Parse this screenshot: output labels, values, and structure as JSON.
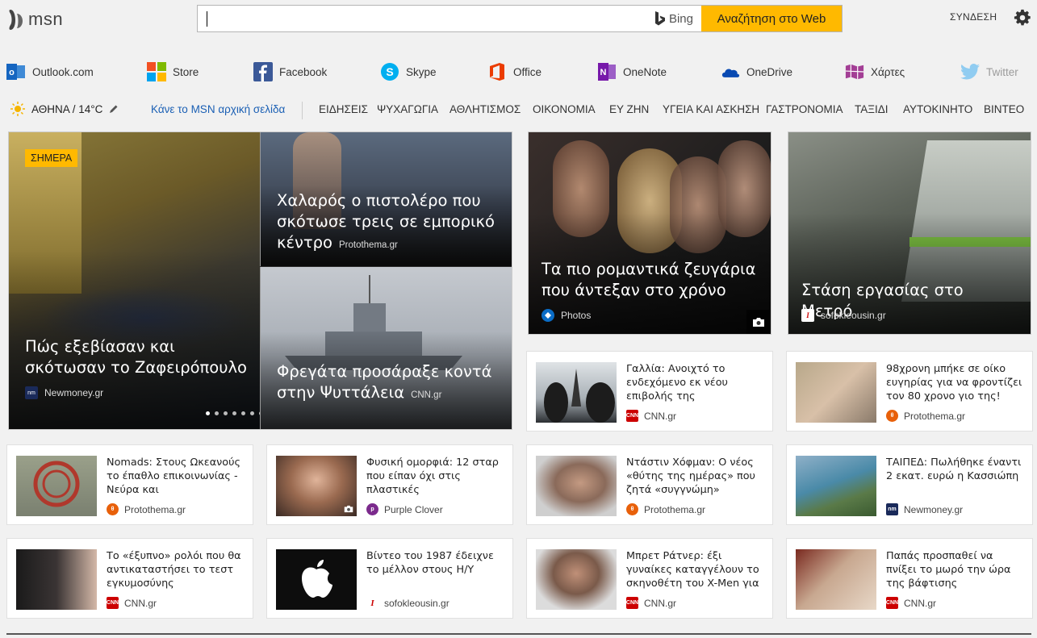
{
  "header": {
    "logo_text": "msn",
    "search_placeholder": "",
    "bing_label": "Bing",
    "search_button": "Αναζήτηση στο Web",
    "signin": "ΣΥΝΔΕΣΗ"
  },
  "services": [
    {
      "label": "Outlook.com",
      "icon": "outlook-icon"
    },
    {
      "label": "Store",
      "icon": "store-icon"
    },
    {
      "label": "Facebook",
      "icon": "facebook-icon"
    },
    {
      "label": "Skype",
      "icon": "skype-icon"
    },
    {
      "label": "Office",
      "icon": "office-icon"
    },
    {
      "label": "OneNote",
      "icon": "onenote-icon"
    },
    {
      "label": "OneDrive",
      "icon": "onedrive-icon"
    },
    {
      "label": "Χάρτες",
      "icon": "maps-icon"
    },
    {
      "label": "Twitter",
      "icon": "twitter-icon"
    }
  ],
  "weather": {
    "location": "ΑΘΗΝΑ / 14°C"
  },
  "make_homepage": "Κάνε το MSN αρχική σελίδα",
  "categories": [
    "ΕΙΔΗΣΕΙΣ",
    "ΨΥΧΑΓΩΓΙΑ",
    "ΑΘΛΗΤΙΣΜΟΣ",
    "ΟΙΚΟΝΟΜΙΑ",
    "ΕΥ ΖΗΝ",
    "ΥΓΕΙΑ ΚΑΙ ΑΣΚΗΣΗ",
    "ΓΑΣΤΡΟΝΟΜΙΑ",
    "ΤΑΞΙΔΙ",
    "ΑΥΤΟΚΙΝΗΤΟ",
    "ΒΙΝΤΕΟ"
  ],
  "hero": {
    "badge": "ΣΗΜΕΡΑ",
    "main": {
      "title": "Πώς εξεβίασαν και σκότωσαν το Ζαφειρόπουλο",
      "source": "Newmoney.gr"
    },
    "top_right": {
      "title": "Χαλαρός ο πιστολέρο που σκότωσε τρεις σε εμπορικό κέντρο",
      "source": "Protothema.gr"
    },
    "bottom_right": {
      "title": "Φρεγάτα προσάραξε κοντά στην Ψυττάλεια",
      "source": "CNN.gr"
    }
  },
  "big_tiles": [
    {
      "title": "Τα πιο ρομαντικά ζευγάρια που άντεξαν στο χρόνο",
      "source": "Photos"
    },
    {
      "title": "Στάση εργασίας στο Μετρό",
      "source": "sofokleousin.gr"
    }
  ],
  "cards": [
    {
      "title": "Γαλλία: Ανοιχτό το ενδεχόμενο εκ νέου επιβολής της κατάστασης...",
      "source": "CNN.gr"
    },
    {
      "title": "98χρονη μπήκε σε οίκο ευγηρίας για να φροντίζει τον 80 χρονο γιο της!",
      "source": "Protothema.gr"
    },
    {
      "title": "Nomads: Στους Ωκεανούς το έπαθλο επικοινωνίας - Νεύρα και αντιπαραθέσεις...",
      "source": "Protothema.gr"
    },
    {
      "title": "Φυσική ομορφιά: 12 σταρ που είπαν όχι στις πλαστικές",
      "source": "Purple Clover"
    },
    {
      "title": "Ντάστιν Χόφμαν: Ο νέος «θύτης της ημέρας» που ζητά «συγγνώμη» κατόπιν...",
      "source": "Protothema.gr"
    },
    {
      "title": "ΤΑΙΠΕΔ: Πωλήθηκε έναντι 2 εκατ. ευρώ η Κασσιώπη",
      "source": "Newmoney.gr"
    },
    {
      "title": "Το «έξυπνο» ρολόι που θα αντικαταστήσει το τεστ εγκυμοσύνης",
      "source": "CNN.gr"
    },
    {
      "title": "Βίντεο του 1987 έδειχνε το μέλλον στους Η/Υ",
      "source": "sofokleousin.gr"
    },
    {
      "title": "Μπρετ Ράτνερ: έξι γυναίκες καταγγέλουν το σκηνοθέτη του X-Men για σεξουαλική...",
      "source": "CNN.gr"
    },
    {
      "title": "Παπάς προσπαθεί να πνίξει το μωρό την ώρα της βάφτισης",
      "source": "CNN.gr"
    }
  ],
  "colors": {
    "accent": "#ffb900",
    "link": "#1a5fb4",
    "bg": "#f1f1f1"
  }
}
